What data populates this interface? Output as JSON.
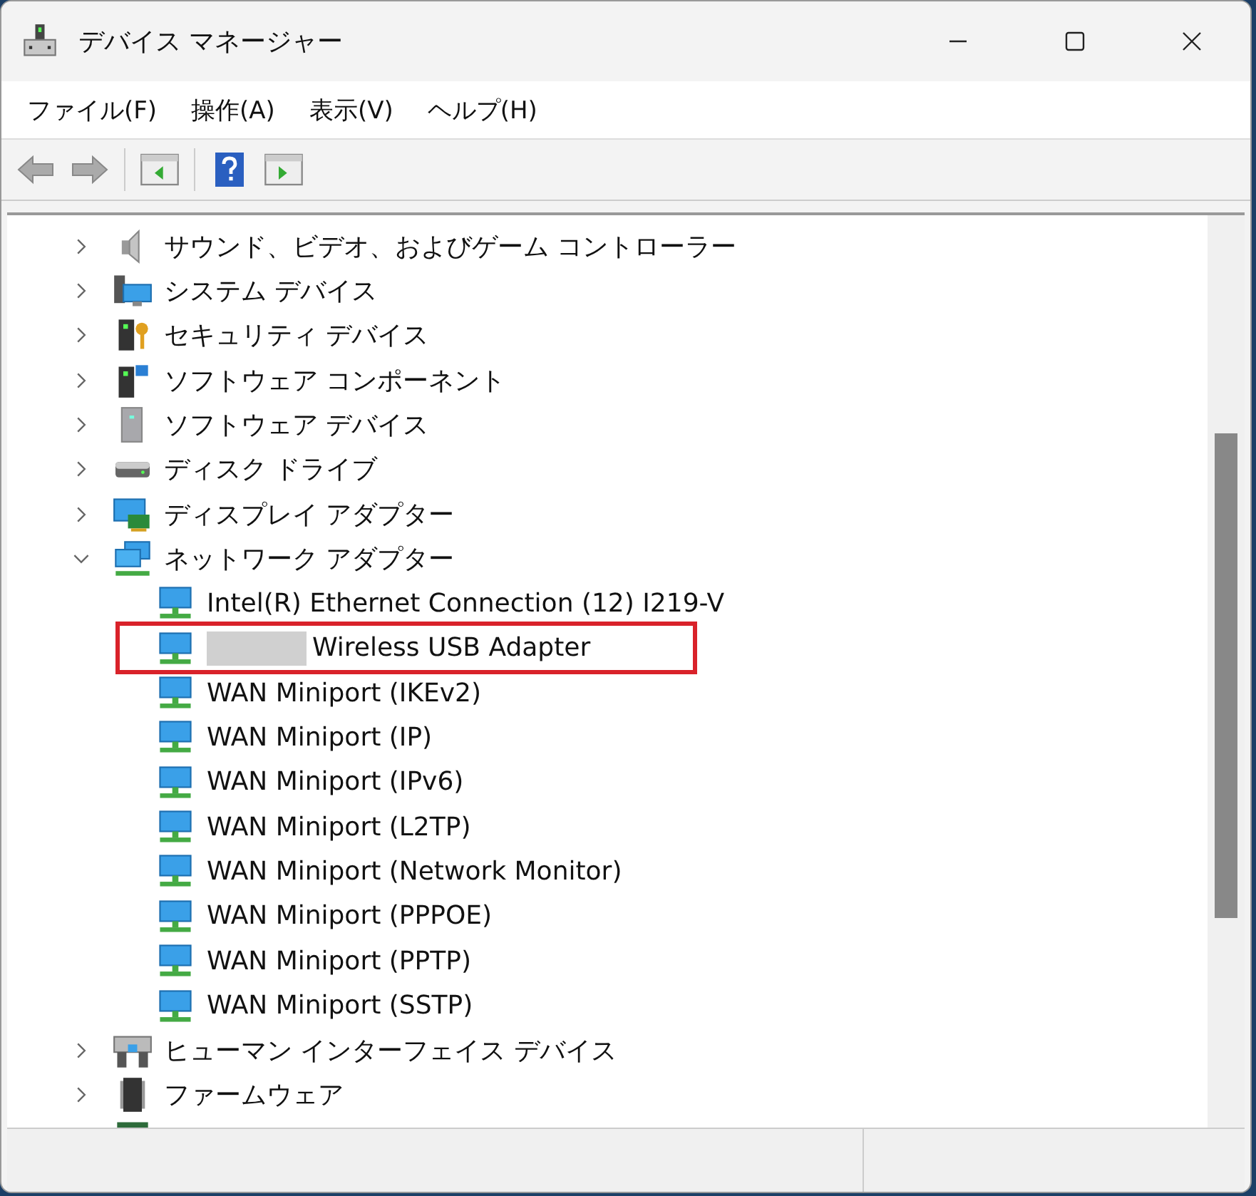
{
  "window": {
    "title": "デバイス マネージャー"
  },
  "menu": [
    "ファイル(F)",
    "操作(A)",
    "表示(V)",
    "ヘルプ(H)"
  ],
  "tree": [
    {
      "label": "サウンド、ビデオ、およびゲーム コントローラー",
      "kind": "speaker",
      "expanded": false
    },
    {
      "label": "システム デバイス",
      "kind": "system",
      "expanded": false
    },
    {
      "label": "セキュリティ デバイス",
      "kind": "security",
      "expanded": false
    },
    {
      "label": "ソフトウェア コンポーネント",
      "kind": "component",
      "expanded": false
    },
    {
      "label": "ソフトウェア デバイス",
      "kind": "tower",
      "expanded": false
    },
    {
      "label": "ディスク ドライブ",
      "kind": "disk",
      "expanded": false
    },
    {
      "label": "ディスプレイ アダプター",
      "kind": "display",
      "expanded": false
    },
    {
      "label": "ネットワーク アダプター",
      "kind": "network",
      "expanded": true,
      "children": [
        {
          "label": "Intel(R) Ethernet Connection (12) I219-V",
          "redacted": false,
          "highlighted": false
        },
        {
          "label": "Wireless USB Adapter",
          "redacted": true,
          "highlighted": true
        },
        {
          "label": "WAN Miniport (IKEv2)",
          "redacted": false,
          "highlighted": false
        },
        {
          "label": "WAN Miniport (IP)",
          "redacted": false,
          "highlighted": false
        },
        {
          "label": "WAN Miniport (IPv6)",
          "redacted": false,
          "highlighted": false
        },
        {
          "label": "WAN Miniport (L2TP)",
          "redacted": false,
          "highlighted": false
        },
        {
          "label": "WAN Miniport (Network Monitor)",
          "redacted": false,
          "highlighted": false
        },
        {
          "label": "WAN Miniport (PPPOE)",
          "redacted": false,
          "highlighted": false
        },
        {
          "label": "WAN Miniport (PPTP)",
          "redacted": false,
          "highlighted": false
        },
        {
          "label": "WAN Miniport (SSTP)",
          "redacted": false,
          "highlighted": false
        }
      ]
    },
    {
      "label": "ヒューマン インターフェイス デバイス",
      "kind": "hid",
      "expanded": false
    },
    {
      "label": "ファームウェア",
      "kind": "chip",
      "expanded": false
    }
  ]
}
